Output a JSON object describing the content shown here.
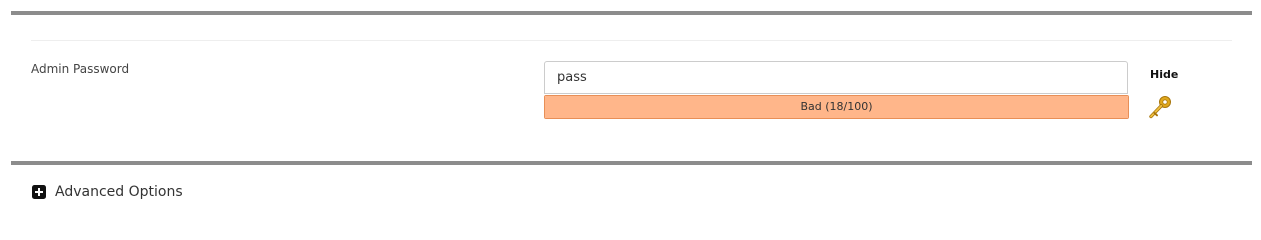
{
  "admin_password": {
    "label": "Admin Password",
    "value": "pass",
    "toggle_label": "Hide",
    "strength": {
      "text": "Bad (18/100)",
      "score": 18,
      "max": 100,
      "fill_color": "#ffb68a",
      "border_color": "#e88f57"
    },
    "generate_icon": "key-icon"
  },
  "advanced_options": {
    "label": "Advanced Options",
    "icon": "plus-square-icon"
  },
  "colors": {
    "rule": "#8c8c8c",
    "key": "#e0a81c"
  }
}
